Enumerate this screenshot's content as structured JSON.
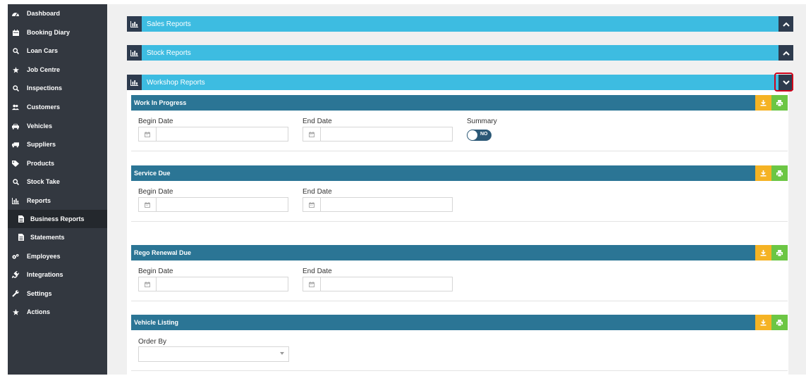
{
  "sidebar": {
    "items": [
      {
        "label": "Dashboard",
        "icon": "dashboard-icon"
      },
      {
        "label": "Booking Diary",
        "icon": "calendar-icon"
      },
      {
        "label": "Loan Cars",
        "icon": "search-icon"
      },
      {
        "label": "Job Centre",
        "icon": "star-icon"
      },
      {
        "label": "Inspections",
        "icon": "search-icon"
      },
      {
        "label": "Customers",
        "icon": "users-icon"
      },
      {
        "label": "Vehicles",
        "icon": "car-icon"
      },
      {
        "label": "Suppliers",
        "icon": "truck-icon"
      },
      {
        "label": "Products",
        "icon": "tag-icon"
      },
      {
        "label": "Stock Take",
        "icon": "search-icon"
      },
      {
        "label": "Reports",
        "icon": "bar-chart-icon"
      },
      {
        "label": "Business Reports",
        "icon": "document-icon",
        "active": true
      },
      {
        "label": "Statements",
        "icon": "document-icon"
      },
      {
        "label": "Employees",
        "icon": "cogs-icon"
      },
      {
        "label": "Integrations",
        "icon": "plug-icon"
      },
      {
        "label": "Settings",
        "icon": "wrench-icon"
      },
      {
        "label": "Actions",
        "icon": "star-icon"
      }
    ]
  },
  "panels": [
    {
      "title": "Sales Reports",
      "icon": "bar-chart-icon",
      "toggle": "chevron-up-icon"
    },
    {
      "title": "Stock Reports",
      "icon": "bar-chart-icon",
      "toggle": "chevron-up-icon"
    },
    {
      "title": "Workshop Reports",
      "icon": "bar-chart-icon",
      "toggle": "chevron-down-icon"
    }
  ],
  "reports": {
    "wip": {
      "title": "Work In Progress",
      "begin_label": "Begin Date",
      "end_label": "End Date",
      "summary_label": "Summary",
      "summary_value": "NO"
    },
    "service_due": {
      "title": "Service Due",
      "begin_label": "Begin Date",
      "end_label": "End Date"
    },
    "rego_due": {
      "title": "Rego Renewal Due",
      "begin_label": "Begin Date",
      "end_label": "End Date"
    },
    "vehicle_listing": {
      "title": "Vehicle Listing",
      "order_label": "Order By",
      "order_value": ""
    }
  },
  "colors": {
    "sidebar_bg": "#333840",
    "panel_header": "#3dbce1",
    "report_header": "#2b7595",
    "download_button": "#f5b324",
    "print_button": "#6cc644",
    "highlight": "#d0021b"
  }
}
